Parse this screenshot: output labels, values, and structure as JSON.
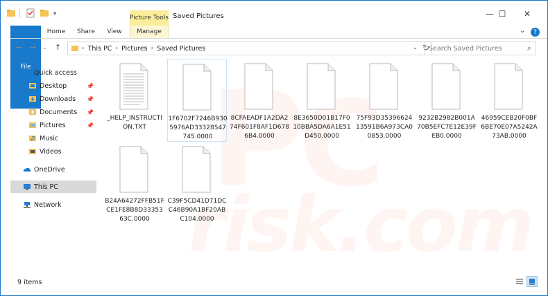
{
  "window": {
    "title": "Saved Pictures",
    "context_tab": "Picture Tools"
  },
  "ribbon": {
    "tabs": [
      {
        "label": "File"
      },
      {
        "label": "Home"
      },
      {
        "label": "Share"
      },
      {
        "label": "View"
      },
      {
        "label": "Manage"
      }
    ]
  },
  "address": {
    "crumbs": [
      "This PC",
      "Pictures",
      "Saved Pictures"
    ],
    "search_placeholder": "Search Saved Pictures"
  },
  "sidebar": {
    "items": [
      {
        "label": "Quick access",
        "icon": "star-icon",
        "pinned": false
      },
      {
        "label": "Desktop",
        "icon": "desktop-folder-icon",
        "pinned": true
      },
      {
        "label": "Downloads",
        "icon": "downloads-folder-icon",
        "pinned": true
      },
      {
        "label": "Documents",
        "icon": "documents-folder-icon",
        "pinned": true
      },
      {
        "label": "Pictures",
        "icon": "pictures-folder-icon",
        "pinned": true
      },
      {
        "label": "Music",
        "icon": "music-folder-icon",
        "pinned": false
      },
      {
        "label": "Videos",
        "icon": "videos-folder-icon",
        "pinned": false
      },
      {
        "label": "OneDrive",
        "icon": "onedrive-cloud-icon",
        "pinned": false
      },
      {
        "label": "This PC",
        "icon": "computer-icon",
        "pinned": false,
        "selected": true
      },
      {
        "label": "Network",
        "icon": "network-icon",
        "pinned": false
      }
    ]
  },
  "files": [
    {
      "name": "_HELP_INSTRUCTION.TXT",
      "type": "text"
    },
    {
      "name": "1F6702F7246B9305976AD33328547745.0000",
      "type": "blank",
      "selected": true
    },
    {
      "name": "8CFAEADF1A2DA274F601F8AF1D6786B4.0000",
      "type": "blank"
    },
    {
      "name": "8E3650D01B17F010BBA5DA6A1E51D450.0000",
      "type": "blank"
    },
    {
      "name": "75F93D3539662413591B6A973CA00853.0000",
      "type": "blank"
    },
    {
      "name": "9232B2982B001A70B5EFC7E12E39FEB0.0000",
      "type": "blank"
    },
    {
      "name": "46959CEB20F0BF6BE70E07A5242A73AB.0000",
      "type": "blank"
    },
    {
      "name": "B24A64272FFB51FCE1FE8B8D3335363C.0000",
      "type": "blank"
    },
    {
      "name": "C39F5CD41D71DCC46B90A1BF20ABC104.0000",
      "type": "blank"
    }
  ],
  "status": {
    "item_count": "9 items"
  },
  "watermark": {
    "text": "risk.com"
  },
  "colors": {
    "accent": "#1979ca",
    "context_tab": "#fbee9a"
  }
}
